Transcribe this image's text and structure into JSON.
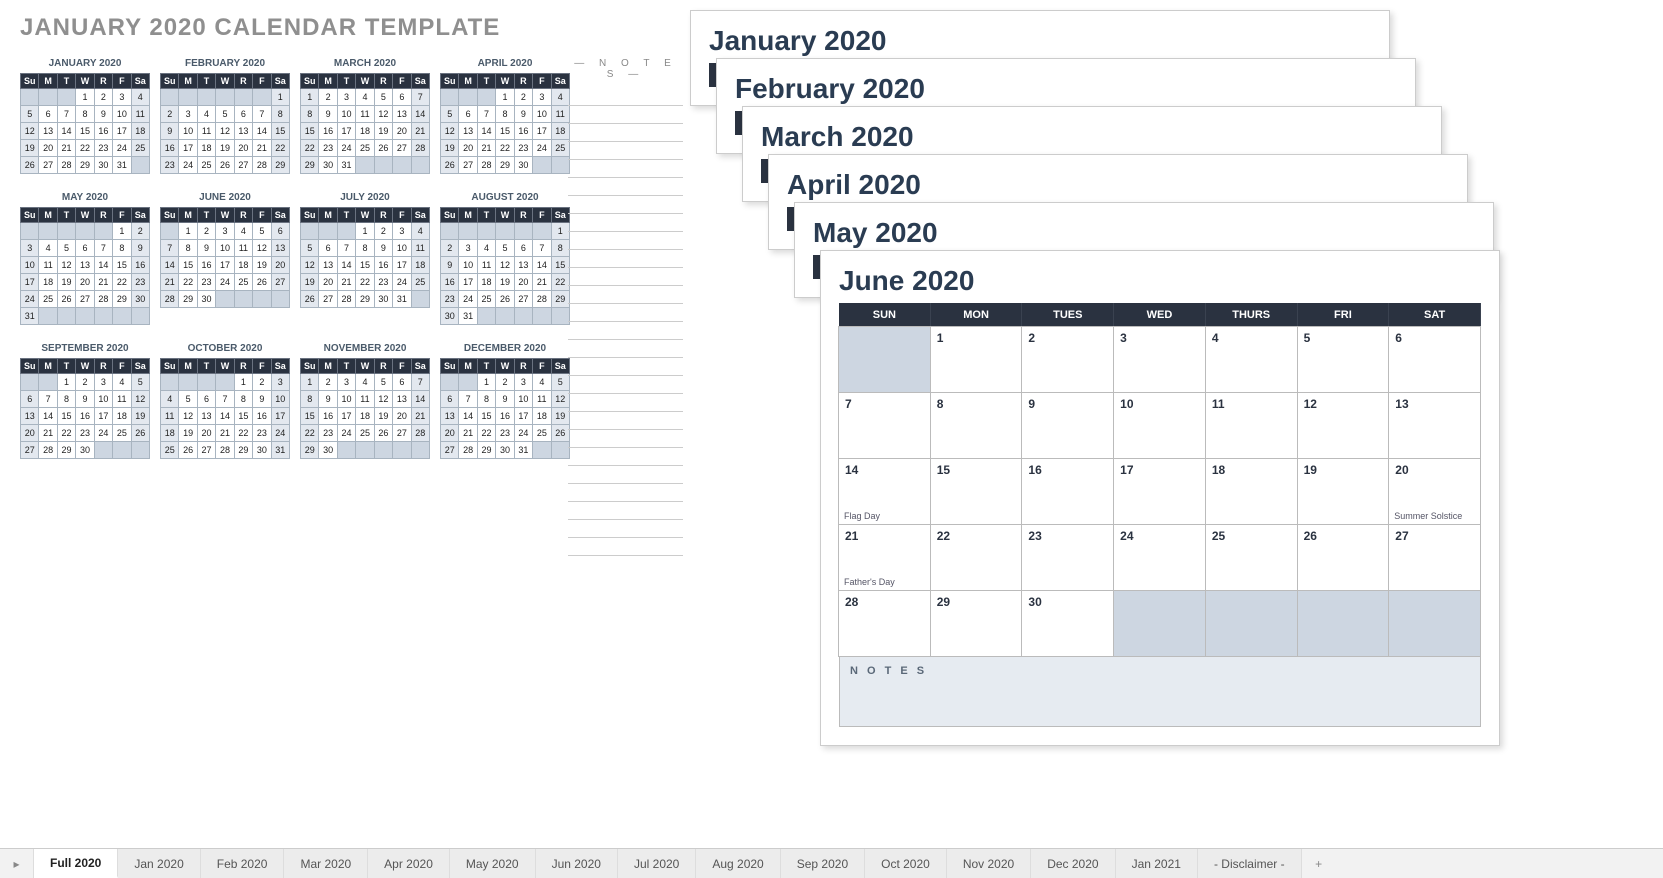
{
  "title": "JANUARY 2020 CALENDAR TEMPLATE",
  "notes_label": "— N O T E S —",
  "dow_mini": [
    "Su",
    "M",
    "T",
    "W",
    "R",
    "F",
    "Sa"
  ],
  "dow_full": [
    "SUN",
    "MON",
    "TUES",
    "WED",
    "THURS",
    "FRI",
    "SAT"
  ],
  "mini": [
    {
      "name": "JANUARY 2020",
      "start": 3,
      "days": 31
    },
    {
      "name": "FEBRUARY 2020",
      "start": 6,
      "days": 29
    },
    {
      "name": "MARCH 2020",
      "start": 0,
      "days": 31
    },
    {
      "name": "APRIL 2020",
      "start": 3,
      "days": 30
    },
    {
      "name": "MAY 2020",
      "start": 5,
      "days": 31
    },
    {
      "name": "JUNE 2020",
      "start": 1,
      "days": 30
    },
    {
      "name": "JULY 2020",
      "start": 3,
      "days": 31
    },
    {
      "name": "AUGUST 2020",
      "start": 6,
      "days": 31
    },
    {
      "name": "SEPTEMBER 2020",
      "start": 2,
      "days": 30
    },
    {
      "name": "OCTOBER 2020",
      "start": 4,
      "days": 31
    },
    {
      "name": "NOVEMBER 2020",
      "start": 0,
      "days": 30
    },
    {
      "name": "DECEMBER 2020",
      "start": 2,
      "days": 31
    }
  ],
  "stack_titles": [
    "January 2020",
    "February 2020",
    "March 2020",
    "April 2020",
    "May 2020",
    "June 2020"
  ],
  "june": {
    "title": "June 2020",
    "start": 1,
    "days": 30,
    "events": {
      "14": "Flag Day",
      "20": "Summer Solstice",
      "21": "Father's Day"
    },
    "notes": "N O T E S"
  },
  "tabs": [
    "Full 2020",
    "Jan 2020",
    "Feb 2020",
    "Mar 2020",
    "Apr 2020",
    "May 2020",
    "Jun 2020",
    "Jul 2020",
    "Aug 2020",
    "Sep 2020",
    "Oct 2020",
    "Nov 2020",
    "Dec 2020",
    "Jan 2021",
    "- Disclaimer -"
  ],
  "active_tab": 0
}
